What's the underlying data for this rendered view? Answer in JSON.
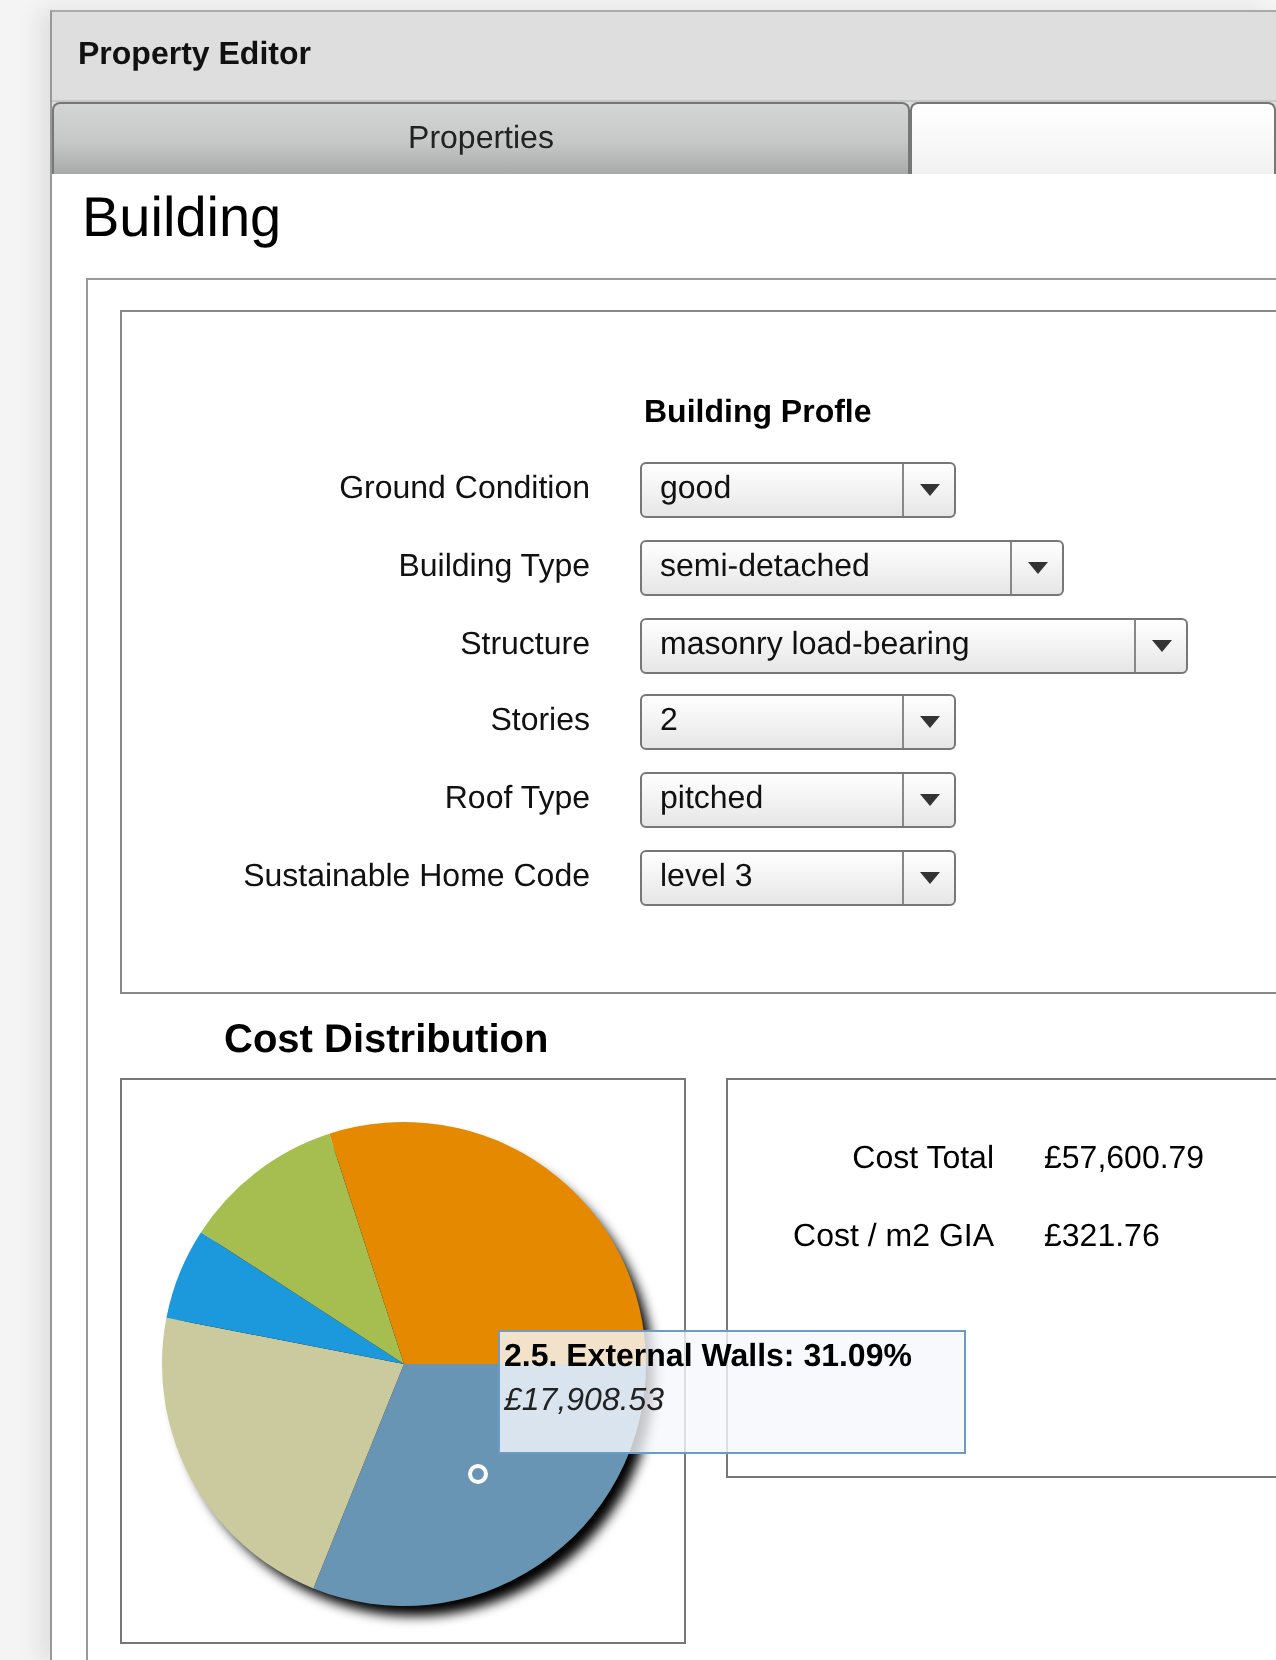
{
  "window": {
    "title": "Property Editor"
  },
  "tabs": [
    {
      "label": "Properties",
      "selected": false
    },
    {
      "selected": true
    }
  ],
  "heading": "Building",
  "profile": {
    "title": "Building Profle",
    "fields": [
      {
        "label": "Ground Condition",
        "value": "good"
      },
      {
        "label": "Building Type",
        "value": "semi-detached"
      },
      {
        "label": "Structure",
        "value": "masonry load-bearing"
      },
      {
        "label": "Stories",
        "value": "2"
      },
      {
        "label": "Roof Type",
        "value": "pitched"
      },
      {
        "label": "Sustainable Home Code",
        "value": "level 3"
      }
    ]
  },
  "cost_distribution": {
    "title": "Cost Distribution",
    "tooltip": {
      "title": "2.5. External Walls: 31.09%",
      "value": "£17,908.53"
    }
  },
  "costs": [
    {
      "label": "Cost Total",
      "value": "£57,600.79"
    },
    {
      "label": "Cost / m2 GIA",
      "value": "£321.76"
    }
  ]
}
